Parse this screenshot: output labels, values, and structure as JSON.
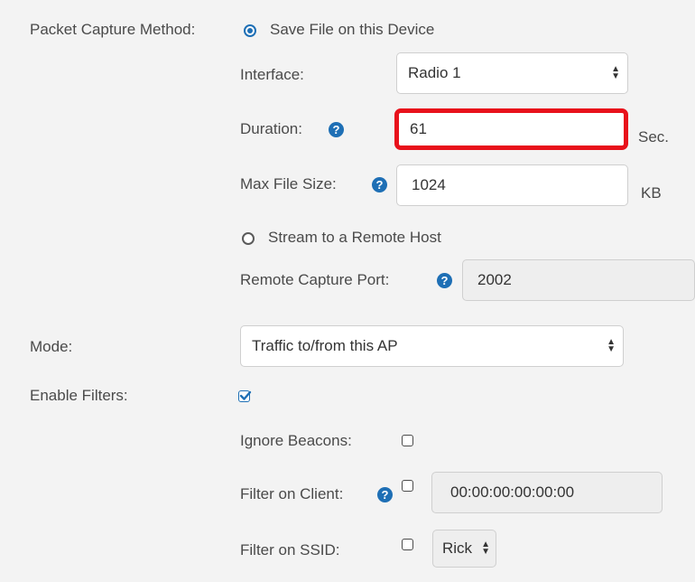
{
  "capture": {
    "method_label": "Packet Capture Method:",
    "option_save": "Save File on this Device",
    "interface_label": "Interface:",
    "interface_value": "Radio 1",
    "duration_label": "Duration:",
    "duration_value": "61",
    "duration_unit": "Sec.",
    "maxfile_label": "Max File Size:",
    "maxfile_value": "1024",
    "maxfile_unit": "KB",
    "option_stream": "Stream to a Remote Host",
    "remote_port_label": "Remote Capture Port:",
    "remote_port_value": "2002"
  },
  "mode": {
    "label": "Mode:",
    "value": "Traffic to/from this AP"
  },
  "filters": {
    "enable_label": "Enable Filters:",
    "enabled": true,
    "ignore_beacons_label": "Ignore Beacons:",
    "filter_client_label": "Filter on Client:",
    "filter_client_value": "00:00:00:00:00:00",
    "filter_ssid_label": "Filter on SSID:",
    "filter_ssid_value": "Rick"
  },
  "icons": {
    "help": "question-circle-icon",
    "select_arrows": "up-down-arrows-icon"
  },
  "colors": {
    "accent": "#1e6fb5",
    "highlight": "#e8111b",
    "panel_bg": "#f3f3f3"
  },
  "help_glyph": "?",
  "select_glyphs": [
    "▲",
    "▼"
  ]
}
